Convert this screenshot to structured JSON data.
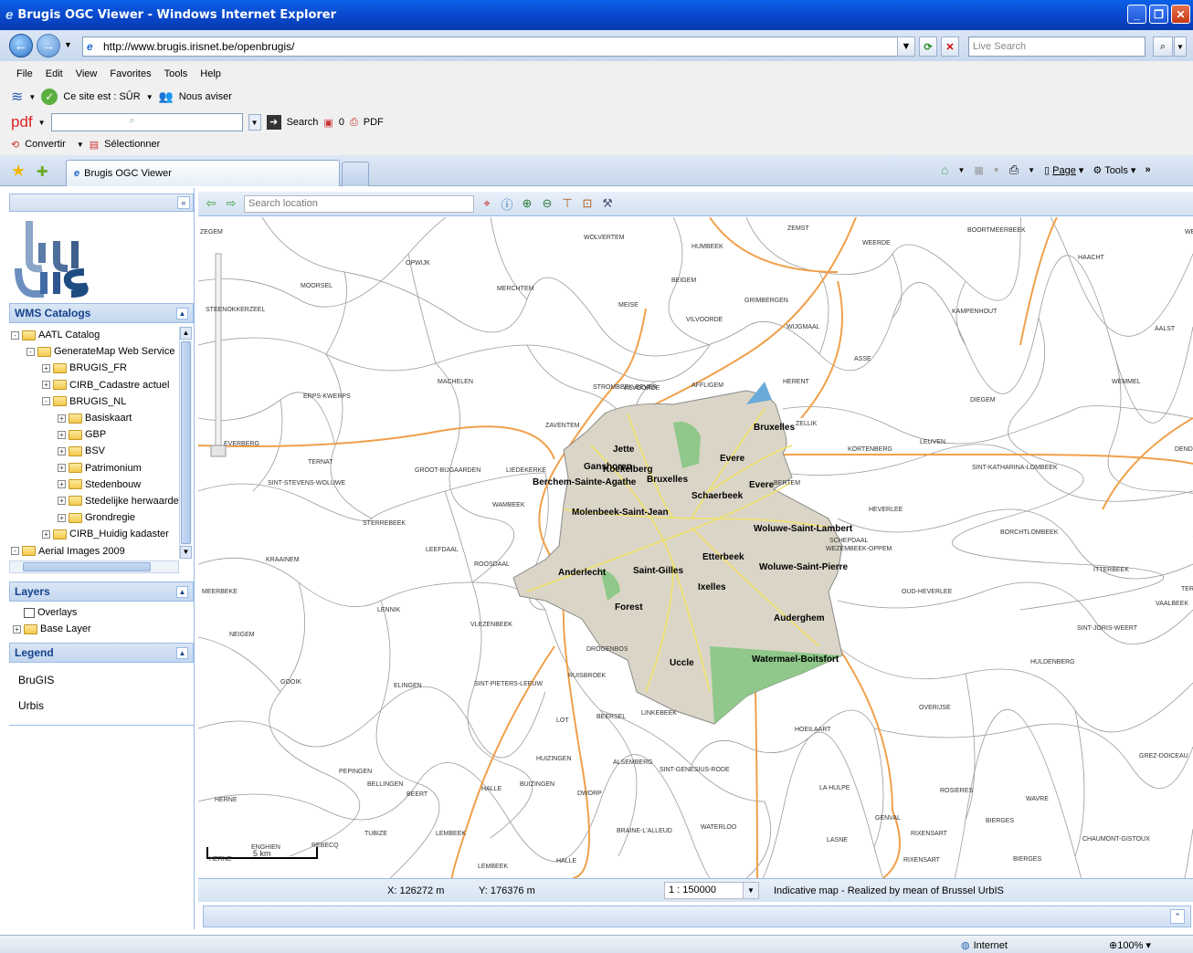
{
  "window": {
    "title": "Brugis OGC Viewer - Windows Internet Explorer"
  },
  "browser": {
    "url": "http://www.brugis.irisnet.be/openbrugis/",
    "live_search_placeholder": "Live Search",
    "menu": [
      "File",
      "Edit",
      "View",
      "Favorites",
      "Tools",
      "Help"
    ],
    "safe_text": "Ce site est : SÛR",
    "advise_text": "Nous aviser",
    "pdf_label": "pdf",
    "search_label": "Search",
    "count_label": "0",
    "pdf_button": "PDF",
    "convert_label": "Convertir",
    "select_label": "Sélectionner",
    "tab_title": "Brugis OGC Viewer",
    "page_menu": "Page",
    "tools_menu": "Tools",
    "zone": "Internet",
    "zoom": "100%"
  },
  "sidebar": {
    "wms_title": "WMS Catalogs",
    "tree": [
      {
        "label": "AATL Catalog",
        "depth": 0,
        "sign": "-"
      },
      {
        "label": "GenerateMap Web Service",
        "depth": 1,
        "sign": "-"
      },
      {
        "label": "BRUGIS_FR",
        "depth": 2,
        "sign": "+"
      },
      {
        "label": "CIRB_Cadastre actuel",
        "depth": 2,
        "sign": "+"
      },
      {
        "label": "BRUGIS_NL",
        "depth": 2,
        "sign": "-"
      },
      {
        "label": "Basiskaart",
        "depth": 3,
        "sign": "+"
      },
      {
        "label": "GBP",
        "depth": 3,
        "sign": "+"
      },
      {
        "label": "BSV",
        "depth": 3,
        "sign": "+"
      },
      {
        "label": "Patrimonium",
        "depth": 3,
        "sign": "+"
      },
      {
        "label": "Stedenbouw",
        "depth": 3,
        "sign": "+"
      },
      {
        "label": "Stedelijke herwaarde",
        "depth": 3,
        "sign": "+"
      },
      {
        "label": "Grondregie",
        "depth": 3,
        "sign": "+"
      },
      {
        "label": "CIRB_Huidig kadaster",
        "depth": 2,
        "sign": "+"
      },
      {
        "label": "Aerial Images 2009",
        "depth": 0,
        "sign": "-"
      }
    ],
    "layers_title": "Layers",
    "layers": [
      "Overlays",
      "Base Layer"
    ],
    "legend_title": "Legend",
    "legend": [
      "BruGIS",
      "Urbis"
    ]
  },
  "map": {
    "search_placeholder": "Search location",
    "scale_bar": "5 km",
    "x_coord": "X: 126272 m",
    "y_coord": "Y: 176376 m",
    "scale": "1 : 150000",
    "credit": "Indicative map - Realized by mean of Brussel UrbIS",
    "communes": [
      "Bruxelles",
      "Jette",
      "Ganshoren",
      "Evere",
      "Berchem-Sainte-Agathe",
      "Bruxelles",
      "Koekelberg",
      "Schaerbeek",
      "Evere",
      "Molenbeek-Saint-Jean",
      "Woluwe-Saint-Lambert",
      "Etterbeek",
      "Anderlecht",
      "Saint-Gilles",
      "Woluwe-Saint-Pierre",
      "Ixelles",
      "Forest",
      "Auderghem",
      "Watermael-Boitsfort",
      "Uccle"
    ],
    "places": [
      "ZEGEM",
      "WOLVERTEM",
      "HUMBEEK",
      "ZEMST",
      "WEERDE",
      "BOORTMEERBEEK",
      "WER",
      "HAACHT",
      "OPWIJK",
      "BEIGEM",
      "MOORSEL",
      "MERCHTEM",
      "MEISE",
      "GRIMBERGEN",
      "KAMPENHOUT",
      "VILVOORDE",
      "WIJGMAAL",
      "AALST",
      "STEENOKKERZEEL",
      "ASSE",
      "MACHELEN",
      "HERENT",
      "WEMMEL",
      "STROMBEEK-BEVER",
      "VILVOORDE",
      "AFFLIGEM",
      "ERPS-KWERPS",
      "DIEGEM",
      "ZELLIK",
      "ZAVENTEM",
      "KORTENBERG",
      "LEUVEN",
      "DENDERLEEUW",
      "EVERBERG",
      "SINT-KATHARINA-LOMBEEK",
      "TERNAT",
      "GROOT-BIJGAARDEN",
      "LIEDEKERKE",
      "SINT-STEVENS-WOLUWE",
      "BERTEM",
      "DILBEEK",
      "WAMBEEK",
      "STERREBEEK",
      "HEVERLEE",
      "BORCHTLOMBEEK",
      "LEEFDAAL",
      "SCHEPDAAL",
      "WEZEMBEEK-OPPEM",
      "KRAAINEM",
      "ROOSDAAL",
      "ITTERBEEK",
      "OUD-HEVERLEE",
      "TERVUREN",
      "VAALBEEK",
      "MEERBEKE",
      "LENNIK",
      "VLEZENBEEK",
      "NEIGEM",
      "SINT-JORIS-WEERT",
      "DROGENBOS",
      "HULDENBERG",
      "GOOIK",
      "ELINGEN",
      "SINT-PIETERS-LEEUW",
      "RUISBROEK",
      "OVERIJSE",
      "LINKEBEEK",
      "BEERSEL",
      "LOT",
      "HOEILAART",
      "GREZ-DOICEAU",
      "HUIZINGEN",
      "ALSEMBERG",
      "SINT-GENESIUS-RODE",
      "PEPINGEN",
      "BELLINGEN",
      "HALLE",
      "BUIZINGEN",
      "DWORP",
      "LA HULPE",
      "ROSIERES",
      "BEERT",
      "HERNE",
      "WAVRE",
      "GENVAL",
      "BIERGES",
      "TUBIZE",
      "LEMBEEK",
      "BRAINE-L'ALLEUD",
      "WATERLOO",
      "RIXENSART",
      "LASNE",
      "CHAUMONT-GISTOUX",
      "ENGHIEN",
      "REBECQ",
      "HERNE",
      "LEMBEEK",
      "HALLE",
      "RIXENSART",
      "BIERGES"
    ]
  }
}
